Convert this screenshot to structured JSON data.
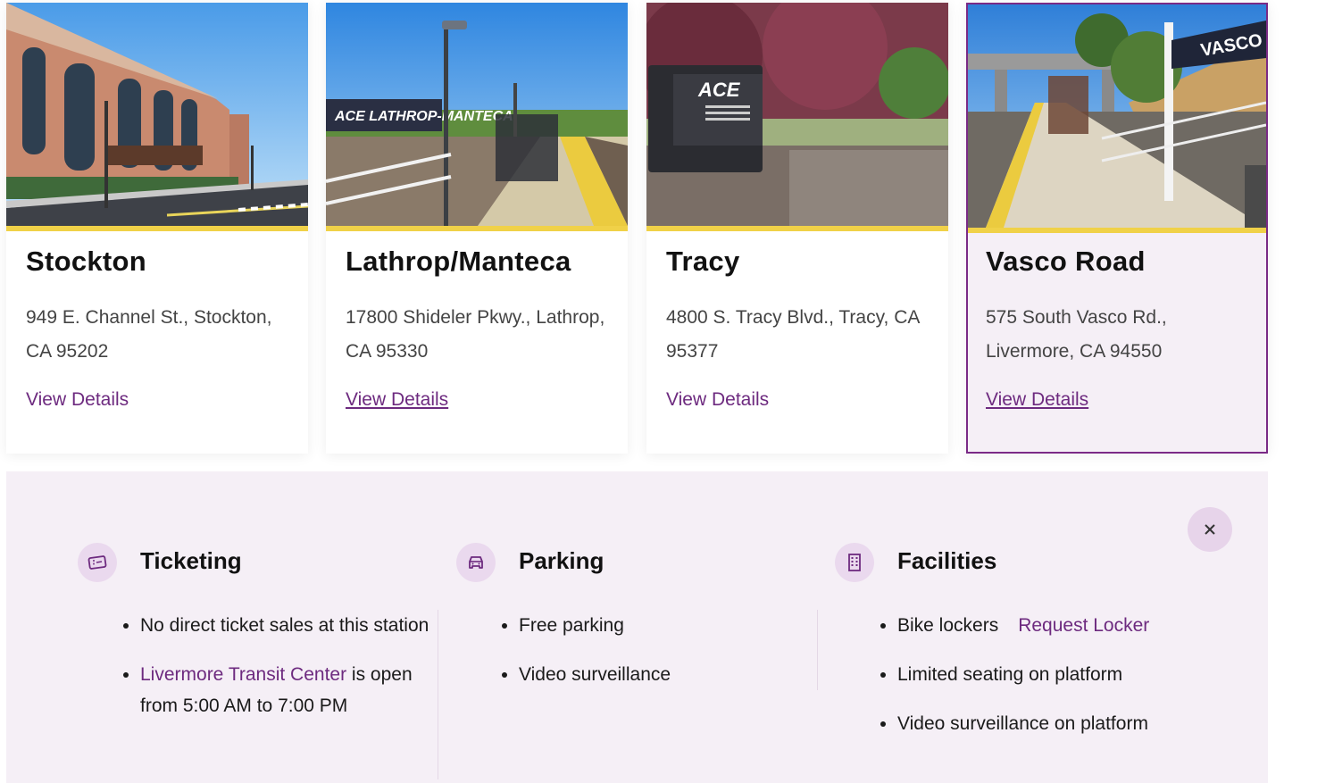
{
  "cards": [
    {
      "title": "Stockton",
      "address": "949 E. Channel St., Stockton, CA 95202",
      "link": "View Details"
    },
    {
      "title": "Lathrop/Manteca",
      "address": "17800 Shideler Pkwy., Lathrop, CA 95330",
      "link": "View Details"
    },
    {
      "title": "Tracy",
      "address": "4800 S. Tracy Blvd., Tracy, CA 95377",
      "link": "View Details"
    },
    {
      "title": "Vasco Road",
      "address": "575 South Vasco Rd., Livermore, CA 94550",
      "link": "View Details",
      "selected": true
    }
  ],
  "photo_signs": {
    "lathrop": "ACE LATHROP-MANTECA",
    "tracy": "ACE",
    "vasco": "VASCO"
  },
  "details": {
    "close_icon": "close-icon",
    "ticketing": {
      "title": "Ticketing",
      "icon": "ticket-icon",
      "item1": "No direct ticket sales at this station",
      "item2_link": "Livermore Transit Center",
      "item2_rest": " is open from 5:00 AM to 7:00 PM"
    },
    "parking": {
      "title": "Parking",
      "icon": "car-icon",
      "items": [
        "Free parking",
        "Video surveillance"
      ]
    },
    "facilities": {
      "title": "Facilities",
      "icon": "building-icon",
      "item1": "Bike lockers",
      "item1_link": "Request Locker",
      "items_rest": [
        "Limited seating on platform",
        "Video surveillance on platform"
      ]
    }
  },
  "colors": {
    "accent": "#6d2a7f",
    "highlight_bar": "#f0d148",
    "panel_bg": "#f5eff6"
  }
}
